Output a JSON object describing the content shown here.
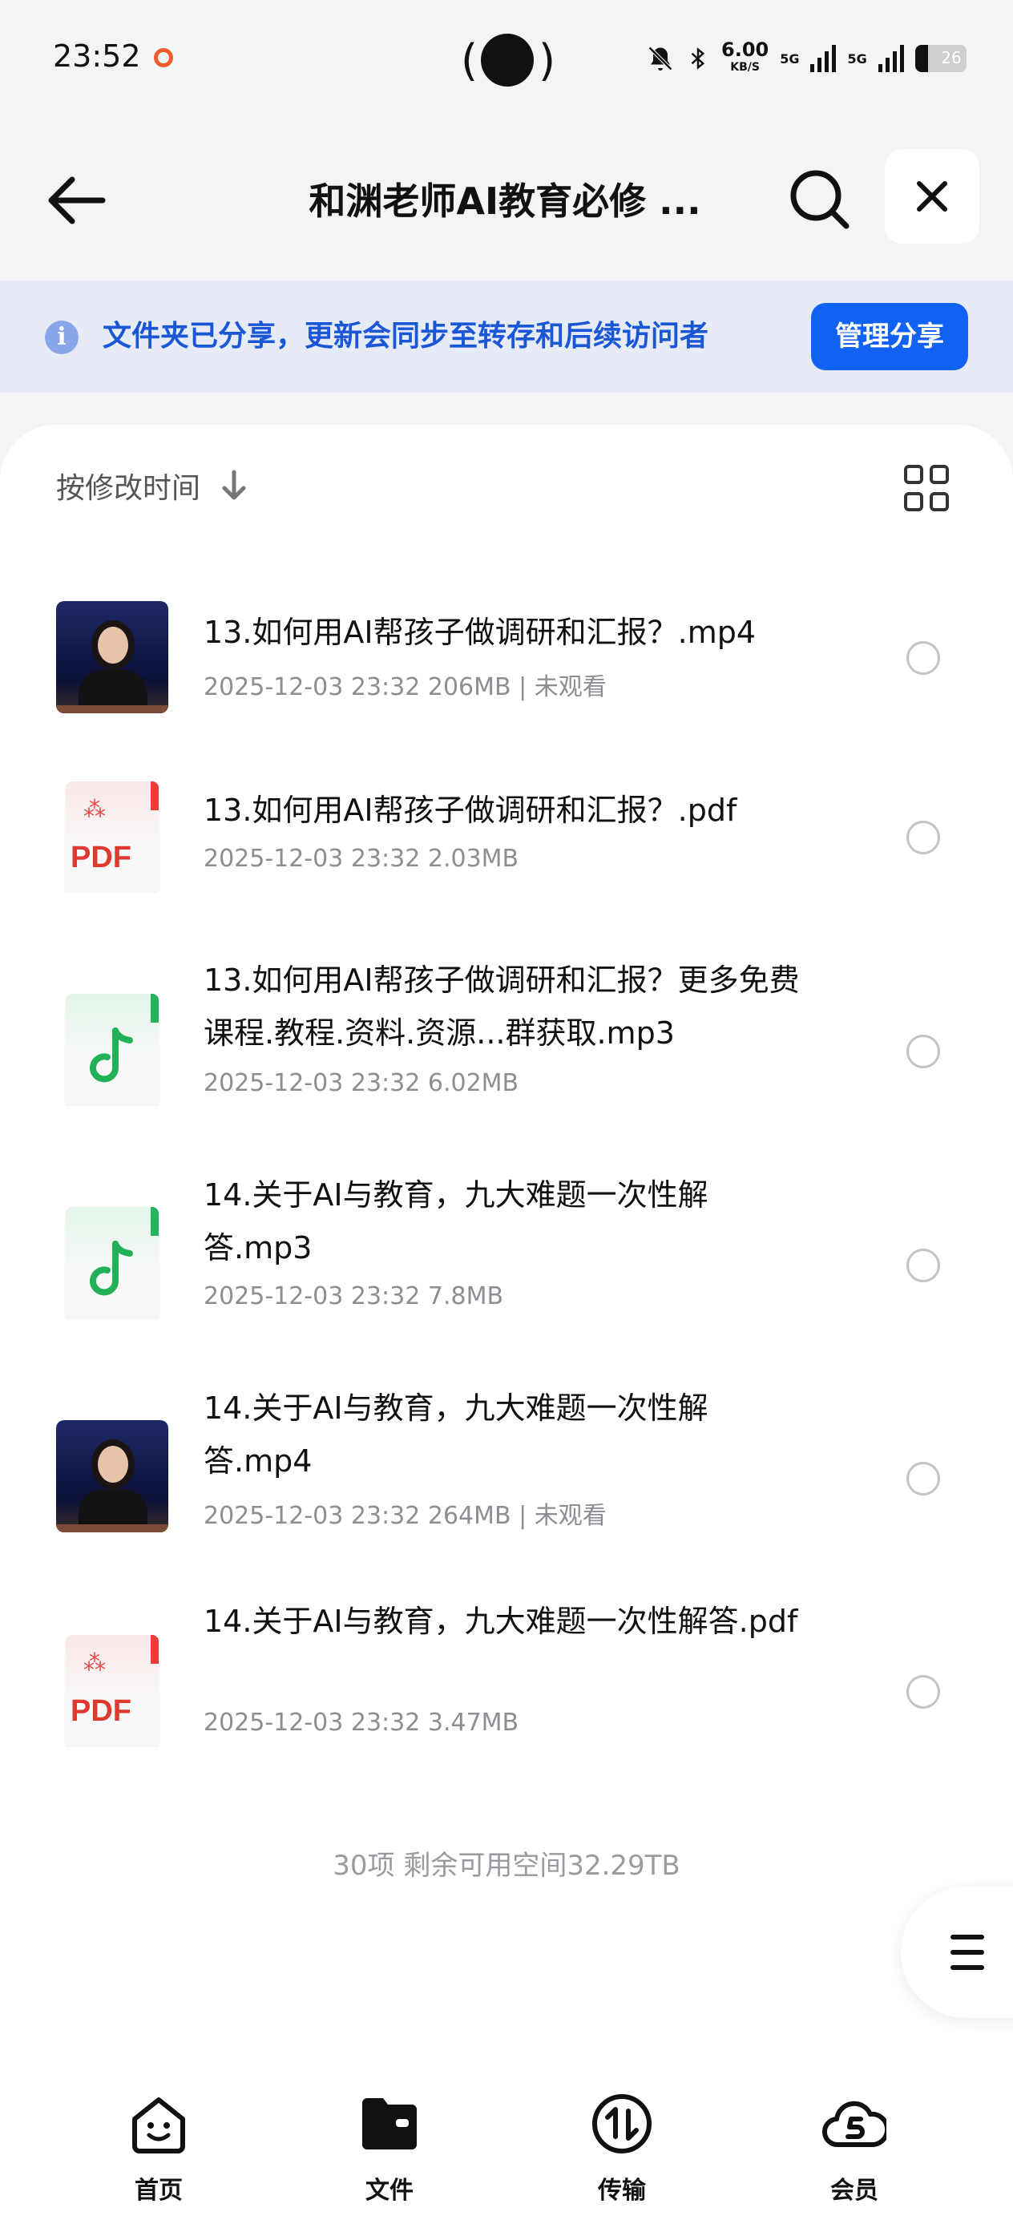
{
  "status_bar": {
    "time": "23:52",
    "net_speed": "6.00",
    "net_unit": "KB/S",
    "sim1": "5G",
    "sim2": "5G",
    "battery": "26",
    "battery_level": 0.26
  },
  "header": {
    "title": "和渊老师AI教育必修 ..."
  },
  "banner": {
    "message": "文件夹已分享，更新会同步至转存和后续访问者",
    "manage_label": "管理分享"
  },
  "toolbar": {
    "sort_label": "按修改时间"
  },
  "files": [
    {
      "name": "13.如何用AI帮孩子做调研和汇报？.mp4",
      "meta": "2025-12-03 23:32  206MB | 未观看",
      "type": "video"
    },
    {
      "name": "13.如何用AI帮孩子做调研和汇报？.pdf",
      "meta": "2025-12-03 23:32  2.03MB",
      "type": "pdf"
    },
    {
      "name": "13.如何用AI帮孩子做调研和汇报？更多免费课程.教程.资料.资源...群获取.mp3",
      "meta": "2025-12-03 23:32  6.02MB",
      "type": "audio"
    },
    {
      "name": "14.关于AI与教育，九大难题一次性解答.mp3",
      "meta": "2025-12-03 23:32  7.8MB",
      "type": "audio"
    },
    {
      "name": "14.关于AI与教育，九大难题一次性解答.mp4",
      "meta": "2025-12-03 23:32  264MB | 未观看",
      "type": "video"
    },
    {
      "name": "14.关于AI与教育，九大难题一次性解答.pdf",
      "meta": "2025-12-03 23:32  3.47MB",
      "type": "pdf"
    }
  ],
  "pdf_badge": "PDF",
  "footer": {
    "count_text": "30项 剩余可用空间32.29TB"
  },
  "bottom_nav": [
    {
      "label": "首页",
      "icon": "home-icon"
    },
    {
      "label": "文件",
      "icon": "folder-icon"
    },
    {
      "label": "传输",
      "icon": "transfer-icon"
    },
    {
      "label": "会员",
      "icon": "vip-cloud-icon"
    }
  ],
  "colors": {
    "accent": "#1162f2",
    "banner_text": "#1a57d6",
    "banner_bg": "#e6ebf7"
  }
}
